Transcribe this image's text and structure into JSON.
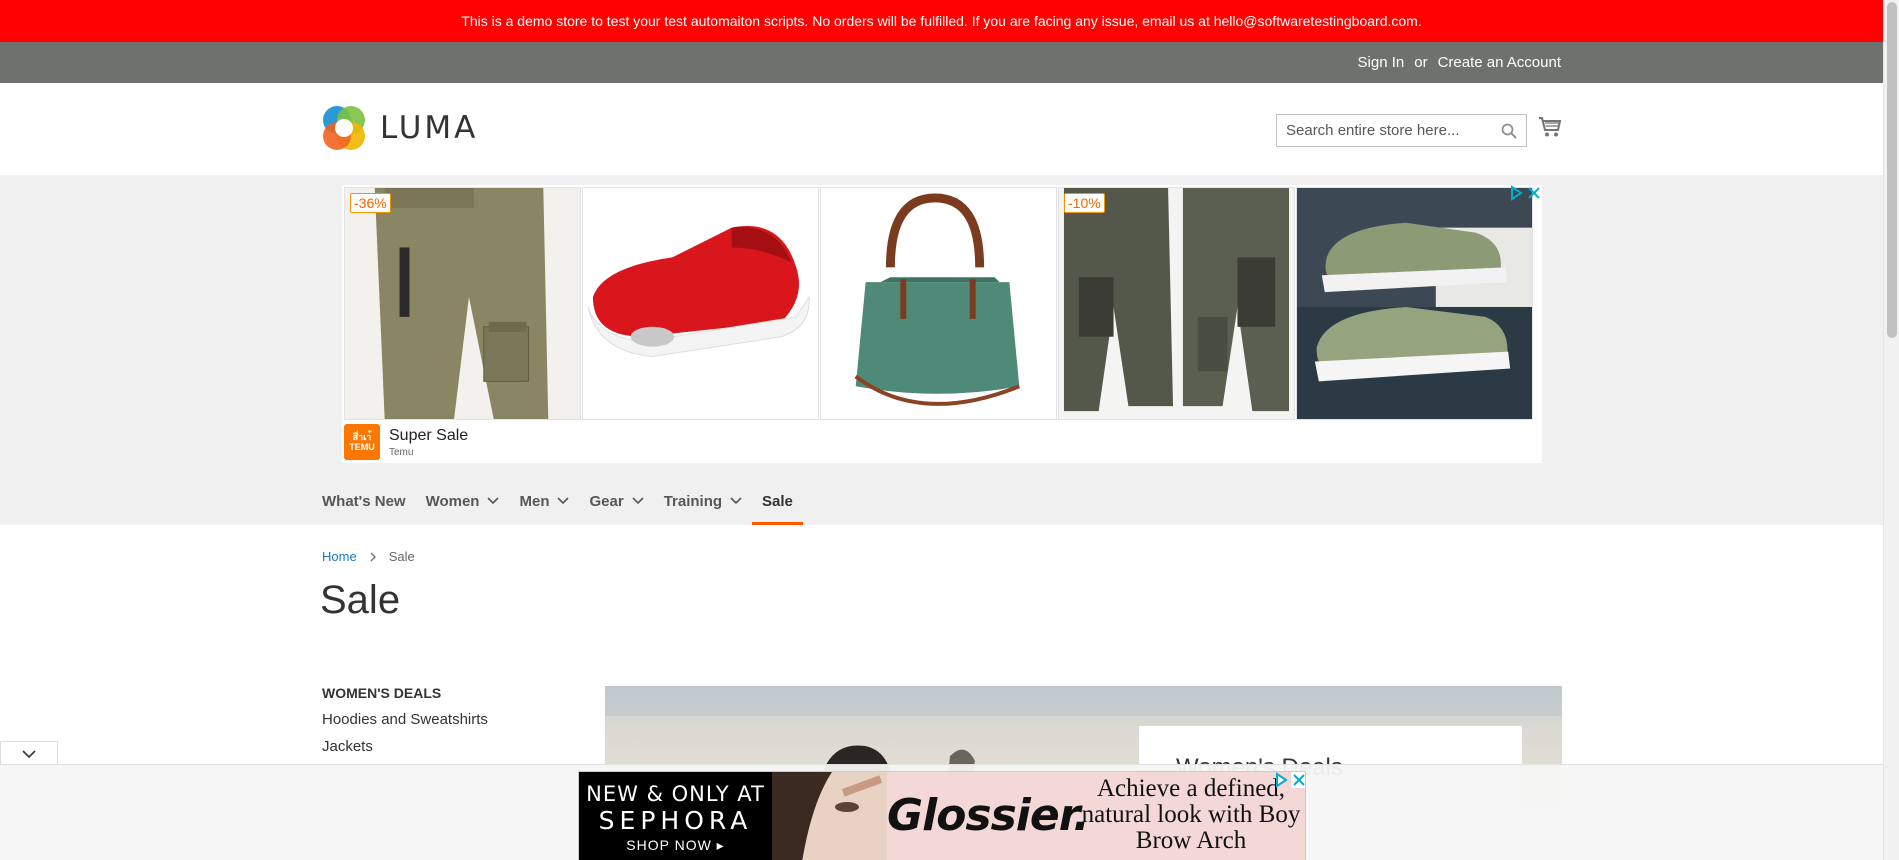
{
  "demo_banner": {
    "text": "This is a demo store to test your test automaiton scripts. No orders will be fulfilled. If you are facing any issue, email us at hello@softwaretestingboard.com."
  },
  "header": {
    "sign_in": "Sign In",
    "or": "or",
    "create_account": "Create an Account",
    "logo_text": "LUMA",
    "search_placeholder": "Search entire store here..."
  },
  "top_ad": {
    "items": [
      {
        "product": "cargo shorts khaki",
        "discount": "-36%"
      },
      {
        "product": "red mesh slip-on shoe",
        "discount": ""
      },
      {
        "product": "green leather handbag",
        "discount": ""
      },
      {
        "product": "dark green cargo shorts",
        "discount": "-10%"
      },
      {
        "product": "olive sneakers",
        "discount": ""
      }
    ],
    "title": "Super Sale",
    "source": "Temu",
    "brand_badge_line1": "สึ่าเา้",
    "brand_badge_line2": "TEMU"
  },
  "nav": {
    "items": [
      {
        "label": "What's New",
        "has_dropdown": false
      },
      {
        "label": "Women",
        "has_dropdown": true
      },
      {
        "label": "Men",
        "has_dropdown": true
      },
      {
        "label": "Gear",
        "has_dropdown": true
      },
      {
        "label": "Training",
        "has_dropdown": true
      },
      {
        "label": "Sale",
        "has_dropdown": false,
        "active": true
      }
    ]
  },
  "breadcrumb": {
    "home": "Home",
    "current": "Sale"
  },
  "page_title": "Sale",
  "sidebar": {
    "heading": "WOMEN'S DEALS",
    "links": [
      "Hoodies and Sweatshirts",
      "Jackets"
    ]
  },
  "hero": {
    "card_title": "Women's Deals"
  },
  "bottom_ad": {
    "sephora_line1": "NEW & ONLY AT",
    "sephora_line2": "SEPHORA",
    "sephora_line3": "SHOP NOW ▸",
    "brand": "Glossier.",
    "tagline": "Achieve a defined, natural look with Boy Brow Arch"
  },
  "colors": {
    "banner": "#ff0101",
    "header_panel": "#6e716e",
    "link": "#1979c3",
    "nav_active": "#ff5501",
    "temu": "#fb7701"
  },
  "icons": [
    "search-icon",
    "cart-icon",
    "chevron-down-icon",
    "chevron-right-icon",
    "adchoices-icon",
    "close-icon"
  ]
}
